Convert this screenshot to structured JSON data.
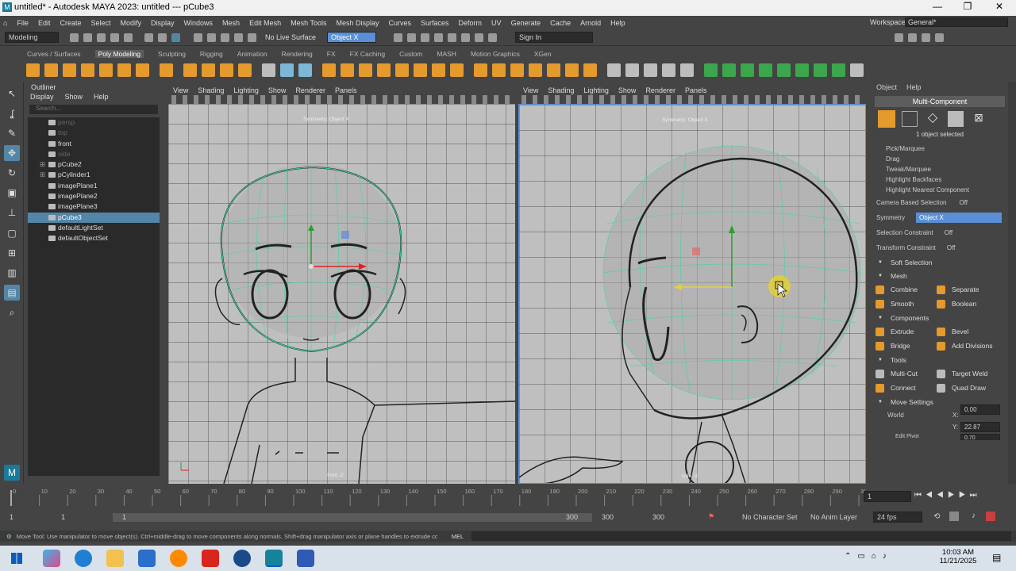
{
  "window": {
    "title": "untitled* - Autodesk MAYA 2023: untitled   ---   pCube3",
    "minimize": "—",
    "maximize": "❐",
    "close": "✕"
  },
  "menubar": [
    "File",
    "Edit",
    "Create",
    "Select",
    "Modify",
    "Display",
    "Windows",
    "Mesh",
    "Edit Mesh",
    "Mesh Tools",
    "Mesh Display",
    "Curves",
    "Surfaces",
    "Deform",
    "UV",
    "Generate",
    "Cache",
    "Arnold",
    "Help"
  ],
  "workspace": {
    "label": "Workspace:",
    "value": "General*"
  },
  "statusline": {
    "mode": "Modeling",
    "live": "No Live Surface",
    "symmetry_field": "Object X",
    "signin": "Sign In"
  },
  "shelf_tabs": [
    "Curves / Surfaces",
    "Poly Modeling",
    "Sculpting",
    "Rigging",
    "Animation",
    "Rendering",
    "FX",
    "FX Caching",
    "Custom",
    "MASH",
    "Motion Graphics",
    "XGen"
  ],
  "shelf_active": "Poly Modeling",
  "outliner": {
    "title": "Outliner",
    "menu": [
      "Display",
      "Show",
      "Help"
    ],
    "search_placeholder": "Search...",
    "items": [
      {
        "label": "persp",
        "dim": true,
        "exp": ""
      },
      {
        "label": "top",
        "dim": true,
        "exp": ""
      },
      {
        "label": "front",
        "dim": false,
        "exp": ""
      },
      {
        "label": "side",
        "dim": true,
        "exp": ""
      },
      {
        "label": "pCube2",
        "dim": false,
        "exp": "⊞"
      },
      {
        "label": "pCylinder1",
        "dim": false,
        "exp": "⊞"
      },
      {
        "label": "imagePlane1",
        "dim": false,
        "exp": ""
      },
      {
        "label": "imagePlane2",
        "dim": false,
        "exp": ""
      },
      {
        "label": "imagePlane3",
        "dim": false,
        "exp": ""
      },
      {
        "label": "pCube3",
        "dim": false,
        "exp": "",
        "selected": true
      },
      {
        "label": "defaultLightSet",
        "dim": false,
        "exp": ""
      },
      {
        "label": "defaultObjectSet",
        "dim": false,
        "exp": ""
      }
    ]
  },
  "viewport_left": {
    "menu": [
      "View",
      "Shading",
      "Lighting",
      "Show",
      "Renderer",
      "Panels"
    ],
    "hud_top": "Symmetry: Object X",
    "hud_bottom": "front -Z"
  },
  "viewport_right": {
    "menu": [
      "View",
      "Shading",
      "Lighting",
      "Show",
      "Renderer",
      "Panels"
    ],
    "hud_top": "Symmetry: Object X",
    "hud_bottom": "side -X"
  },
  "right_panel": {
    "menu": [
      "Object",
      "Help"
    ],
    "title": "Multi-Component",
    "selected": "1 object selected",
    "pick": [
      "Pick/Marquee",
      "Drag",
      "Tweak/Marquee"
    ],
    "highlight_backfaces": "Highlight Backfaces",
    "highlight_nearest": "Highlight Nearest Component",
    "camera_based": {
      "label": "Camera Based Selection",
      "value": "Off"
    },
    "symmetry": {
      "label": "Symmetry",
      "value": "Object X"
    },
    "selection_constraint": {
      "label": "Selection Constraint",
      "value": "Off"
    },
    "transform_constraint": {
      "label": "Transform Constraint",
      "value": "Off"
    },
    "soft_selection": "Soft Selection",
    "mesh": {
      "title": "Mesh",
      "buttons": [
        "Combine",
        "Separate",
        "Smooth",
        "Boolean"
      ]
    },
    "components": {
      "title": "Components",
      "buttons": [
        "Extrude",
        "Bevel",
        "Bridge",
        "Add Divisions"
      ]
    },
    "tools": {
      "title": "Tools",
      "buttons": [
        "Multi-Cut",
        "Target Weld",
        "Connect",
        "Quad Draw"
      ]
    },
    "move_settings": {
      "title": "Move Settings",
      "world": "World",
      "x_label": "X:",
      "x": "0.00",
      "y_label": "Y:",
      "y": "22.87",
      "z": "0.70",
      "edit_pivot": "Edit Pivot"
    }
  },
  "timeline": {
    "ticks": [
      "0",
      "10",
      "20",
      "30",
      "40",
      "50",
      "60",
      "70",
      "80",
      "90",
      "100",
      "110",
      "120",
      "130",
      "140",
      "150",
      "160",
      "170",
      "180",
      "190",
      "200",
      "210",
      "220",
      "230",
      "240",
      "250",
      "260",
      "270",
      "280",
      "290",
      "300"
    ],
    "current": "1"
  },
  "range": {
    "start": "1",
    "start2": "1",
    "slider_start": "1",
    "slider_end": "300",
    "end1": "300",
    "end2": "300",
    "character": "No Character Set",
    "anim_layer": "No Anim Layer",
    "fps": "24 fps"
  },
  "helpline": {
    "text": "Move Tool: Use manipulator to move object(s). Ctrl+middle-drag to move components along normals. Shift+drag manipulator axis or plane handles to extrude components or c",
    "mel": "MEL"
  },
  "taskbar": {
    "time": "10:03 AM",
    "date": "11/21/2025"
  },
  "colors": {
    "accent": "#5285a6",
    "mesh_wire": "#3ad6a8",
    "selected_field": "#5a8fd6"
  }
}
